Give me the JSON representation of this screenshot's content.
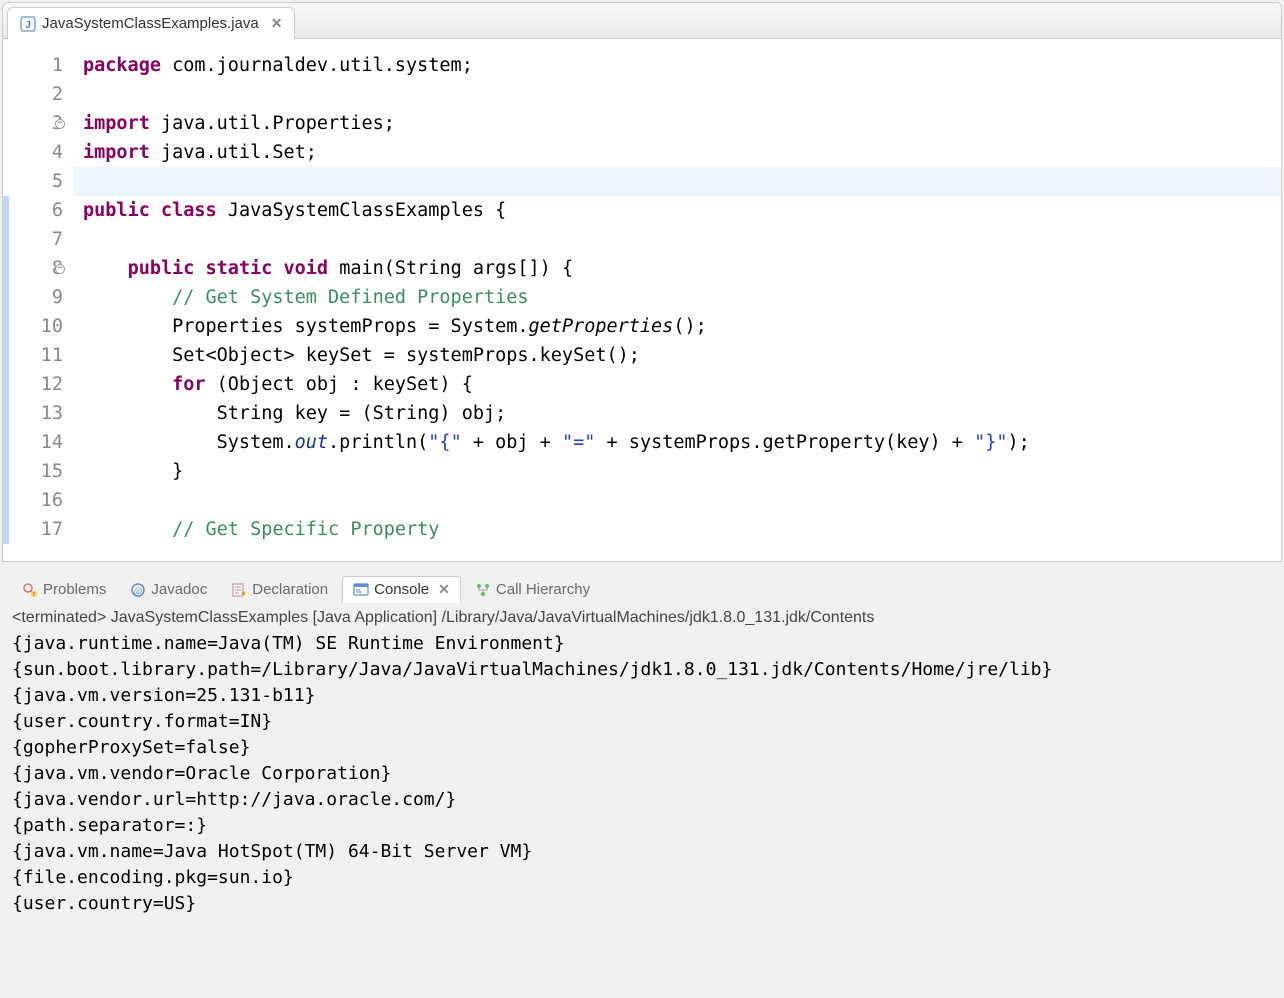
{
  "editor": {
    "tab": {
      "filename": "JavaSystemClassExamples.java",
      "close_glyph": "✕"
    },
    "highlighted_line": 5,
    "fold_markers": [
      3,
      8
    ],
    "quickdiff_start": 6,
    "quickdiff_end": 17,
    "lines": [
      {
        "n": 1,
        "tokens": [
          [
            "kw",
            "package"
          ],
          [
            "pkg",
            " com.journaldev.util.system;"
          ]
        ]
      },
      {
        "n": 2,
        "tokens": []
      },
      {
        "n": 3,
        "tokens": [
          [
            "kw",
            "import"
          ],
          [
            "pkg",
            " java.util.Properties;"
          ]
        ]
      },
      {
        "n": 4,
        "tokens": [
          [
            "kw",
            "import"
          ],
          [
            "pkg",
            " java.util.Set;"
          ]
        ]
      },
      {
        "n": 5,
        "tokens": []
      },
      {
        "n": 6,
        "tokens": [
          [
            "kw",
            "public"
          ],
          [
            "pkg",
            " "
          ],
          [
            "kw",
            "class"
          ],
          [
            "pkg",
            " JavaSystemClassExamples {"
          ]
        ]
      },
      {
        "n": 7,
        "tokens": []
      },
      {
        "n": 8,
        "tokens": [
          [
            "pkg",
            "    "
          ],
          [
            "kw",
            "public"
          ],
          [
            "pkg",
            " "
          ],
          [
            "kw",
            "static"
          ],
          [
            "pkg",
            " "
          ],
          [
            "kw",
            "void"
          ],
          [
            "pkg",
            " main(String args[]) {"
          ]
        ]
      },
      {
        "n": 9,
        "tokens": [
          [
            "pkg",
            "        "
          ],
          [
            "com",
            "// Get System Defined Properties"
          ]
        ]
      },
      {
        "n": 10,
        "tokens": [
          [
            "pkg",
            "        Properties systemProps = System."
          ],
          [
            "ital",
            "getProperties"
          ],
          [
            "pkg",
            "();"
          ]
        ]
      },
      {
        "n": 11,
        "tokens": [
          [
            "pkg",
            "        Set<Object> keySet = systemProps.keySet();"
          ]
        ]
      },
      {
        "n": 12,
        "tokens": [
          [
            "pkg",
            "        "
          ],
          [
            "kw",
            "for"
          ],
          [
            "pkg",
            " (Object obj : keySet) {"
          ]
        ]
      },
      {
        "n": 13,
        "tokens": [
          [
            "pkg",
            "            String key = (String) obj;"
          ]
        ]
      },
      {
        "n": 14,
        "tokens": [
          [
            "pkg",
            "            System."
          ],
          [
            "ital2",
            "out"
          ],
          [
            "pkg",
            ".println("
          ],
          [
            "str",
            "\"{\""
          ],
          [
            "pkg",
            " + obj + "
          ],
          [
            "str",
            "\"=\""
          ],
          [
            "pkg",
            " + systemProps.getProperty(key) + "
          ],
          [
            "str",
            "\"}\""
          ],
          [
            "pkg",
            ");"
          ]
        ]
      },
      {
        "n": 15,
        "tokens": [
          [
            "pkg",
            "        }"
          ]
        ]
      },
      {
        "n": 16,
        "tokens": []
      },
      {
        "n": 17,
        "tokens": [
          [
            "pkg",
            "        "
          ],
          [
            "com",
            "// Get Specific Property"
          ]
        ]
      }
    ]
  },
  "views": {
    "problems": "Problems",
    "javadoc": "Javadoc",
    "declaration": "Declaration",
    "console": "Console",
    "call_hierarchy": "Call Hierarchy",
    "close_glyph": "✕"
  },
  "console": {
    "status": "<terminated> JavaSystemClassExamples [Java Application] /Library/Java/JavaVirtualMachines/jdk1.8.0_131.jdk/Contents",
    "output": [
      "{java.runtime.name=Java(TM) SE Runtime Environment}",
      "{sun.boot.library.path=/Library/Java/JavaVirtualMachines/jdk1.8.0_131.jdk/Contents/Home/jre/lib}",
      "{java.vm.version=25.131-b11}",
      "{user.country.format=IN}",
      "{gopherProxySet=false}",
      "{java.vm.vendor=Oracle Corporation}",
      "{java.vendor.url=http://java.oracle.com/}",
      "{path.separator=:}",
      "{java.vm.name=Java HotSpot(TM) 64-Bit Server VM}",
      "{file.encoding.pkg=sun.io}",
      "{user.country=US}"
    ]
  }
}
